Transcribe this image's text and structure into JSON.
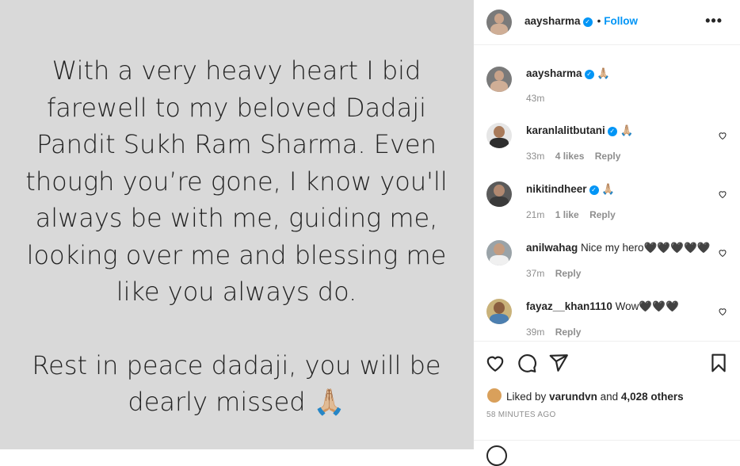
{
  "post": {
    "caption_lines": [
      "With a very heavy heart I bid",
      "farewell to my beloved Dadaji",
      "Pandit Sukh Ram Sharma. Even",
      "though you’re gone, I know you'll",
      "always be with me, guiding me,",
      "looking over me and blessing me",
      "like you always do."
    ],
    "caption_end_lines": [
      "Rest in peace dadaji, you will be",
      "dearly missed 🙏🏼"
    ]
  },
  "header": {
    "username": "aaysharma",
    "verified_icon": "✓",
    "separator": "•",
    "follow_label": "Follow",
    "more_label": "•••"
  },
  "owner_comment": {
    "username": "aaysharma",
    "text": "🙏🏼",
    "time": "43m"
  },
  "comments": [
    {
      "username": "karanlalitbutani",
      "verified": true,
      "text": "🙏🏼",
      "time": "33m",
      "likes": "4 likes",
      "reply": "Reply"
    },
    {
      "username": "nikitindheer",
      "verified": true,
      "text": "🙏🏼",
      "time": "21m",
      "likes": "1 like",
      "reply": "Reply"
    },
    {
      "username": "anilwahag",
      "verified": false,
      "text": "Nice my hero🖤🖤🖤🖤🖤",
      "time": "37m",
      "likes": "",
      "reply": "Reply"
    },
    {
      "username": "fayaz__khan1110",
      "verified": false,
      "text": "Wow🖤🖤🖤",
      "time": "39m",
      "likes": "",
      "reply": "Reply"
    }
  ],
  "actions": {
    "icons": [
      "heart-icon",
      "comment-icon",
      "share-icon",
      "bookmark-icon"
    ]
  },
  "likes": {
    "prefix": "Liked by",
    "user": "varundvn",
    "middle": "and",
    "count": "4,028 others"
  },
  "timestamp": "58 MINUTES AGO",
  "colors": {
    "accent": "#0095f6",
    "post_background": "#d9d9d9",
    "muted_text": "#8e8e8e"
  }
}
